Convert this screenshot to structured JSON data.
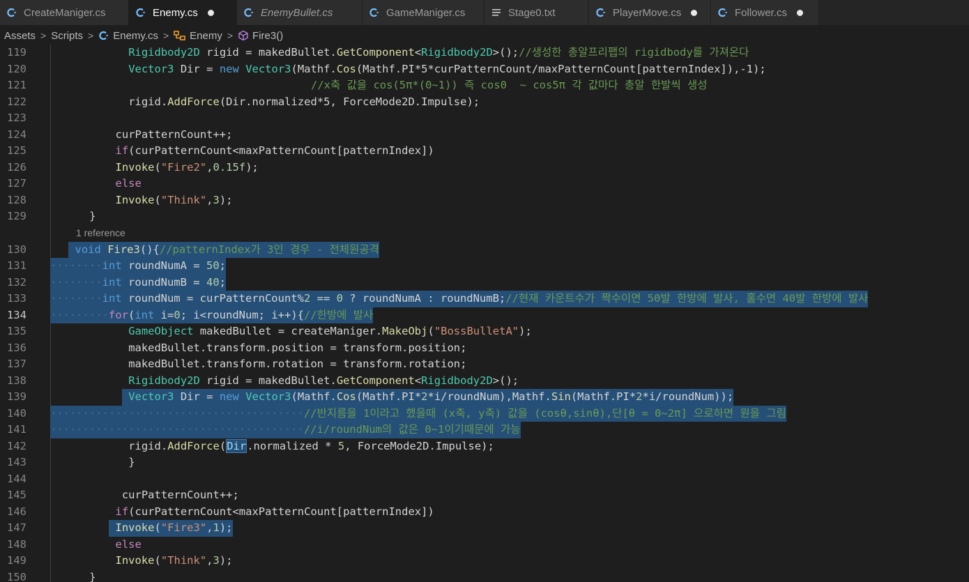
{
  "tabs": [
    {
      "label": "CreateManiger.cs",
      "icon": "csharp-icon",
      "active": false,
      "italic": false,
      "modified": false
    },
    {
      "label": "Enemy.cs",
      "icon": "csharp-icon",
      "active": true,
      "italic": false,
      "modified": true
    },
    {
      "label": "EnemyBullet.cs",
      "icon": "csharp-icon",
      "active": false,
      "italic": true,
      "modified": false
    },
    {
      "label": "GameManiger.cs",
      "icon": "csharp-icon",
      "active": false,
      "italic": false,
      "modified": false
    },
    {
      "label": "Stage0.txt",
      "icon": "text-file-icon",
      "active": false,
      "italic": false,
      "modified": false
    },
    {
      "label": "PlayerMove.cs",
      "icon": "csharp-icon",
      "active": false,
      "italic": false,
      "modified": true
    },
    {
      "label": "Follower.cs",
      "icon": "csharp-icon",
      "active": false,
      "italic": false,
      "modified": true
    }
  ],
  "breadcrumb": {
    "items": [
      "Assets",
      "Scripts",
      "Enemy.cs",
      "Enemy",
      "Fire3()"
    ]
  },
  "codelens": "1 reference",
  "current_line": 134,
  "colors": {
    "background": "#1e1e1e",
    "selection": "#264f78",
    "keyword": "#569cd6",
    "control": "#c586c0",
    "type": "#4ec9b0",
    "function": "#dcdcaa",
    "string": "#ce9178",
    "number": "#b5cea8",
    "comment": "#6a9955",
    "variable": "#9cdcfe"
  },
  "lines": [
    {
      "num": "119",
      "indent": "            ",
      "tokens": [
        [
          "t",
          "Rigidbody2D"
        ],
        [
          "p",
          " rigid = makedBullet."
        ],
        [
          "f",
          "GetComponent"
        ],
        [
          "p",
          "<"
        ],
        [
          "t",
          "Rigidbody2D"
        ],
        [
          "p",
          ">();"
        ],
        [
          "cm",
          "//생성한 총알프리팹의 rigidbody를 가져온다"
        ]
      ]
    },
    {
      "num": "120",
      "indent": "            ",
      "tokens": [
        [
          "t",
          "Vector3"
        ],
        [
          "p",
          " Dir = "
        ],
        [
          "k",
          "new"
        ],
        [
          "p",
          " "
        ],
        [
          "t",
          "Vector3"
        ],
        [
          "p",
          "(Mathf."
        ],
        [
          "f",
          "Cos"
        ],
        [
          "p",
          "(Mathf.PI*5*curPatternCount/maxPatternCount[patternIndex]),-1);"
        ]
      ]
    },
    {
      "num": "121",
      "indent": "                                        ",
      "tokens": [
        [
          "cm",
          "//x축 값을 cos(5π*(0~1)) 즉 cos0  ~ cos5π 각 값마다 총알 한발씩 생성"
        ]
      ]
    },
    {
      "num": "122",
      "indent": "            ",
      "tokens": [
        [
          "p",
          "rigid."
        ],
        [
          "f",
          "AddForce"
        ],
        [
          "p",
          "(Dir.normalized*5, ForceMode2D.Impulse);"
        ]
      ]
    },
    {
      "num": "123",
      "indent": "",
      "tokens": []
    },
    {
      "num": "124",
      "indent": "          ",
      "tokens": [
        [
          "p",
          "curPatternCount++;"
        ]
      ]
    },
    {
      "num": "125",
      "indent": "          ",
      "tokens": [
        [
          "c",
          "if"
        ],
        [
          "p",
          "(curPatternCount<maxPatternCount[patternIndex])"
        ]
      ]
    },
    {
      "num": "126",
      "indent": "          ",
      "tokens": [
        [
          "f",
          "Invoke"
        ],
        [
          "p",
          "("
        ],
        [
          "s",
          "\"Fire2\""
        ],
        [
          "p",
          ","
        ],
        [
          "n",
          "0.15f"
        ],
        [
          "p",
          ");"
        ]
      ]
    },
    {
      "num": "127",
      "indent": "          ",
      "tokens": [
        [
          "c",
          "else"
        ]
      ]
    },
    {
      "num": "128",
      "indent": "          ",
      "tokens": [
        [
          "f",
          "Invoke"
        ],
        [
          "p",
          "("
        ],
        [
          "s",
          "\"Think\""
        ],
        [
          "p",
          ","
        ],
        [
          "n",
          "3"
        ],
        [
          "p",
          ");"
        ]
      ]
    },
    {
      "num": "129",
      "indent": "      ",
      "tokens": [
        [
          "p",
          "}"
        ]
      ]
    },
    {
      "num": "130",
      "indent": "      ",
      "tokens": [
        [
          "k",
          "void"
        ],
        [
          "p",
          " "
        ],
        [
          "f",
          "Fire3"
        ],
        [
          "p",
          "(){"
        ],
        [
          "cm",
          "//patternIndex가 3인 경우 - 전체원공격"
        ]
      ],
      "sel": true
    },
    {
      "num": "131",
      "indent": "        ",
      "tokens": [
        [
          "k",
          "int"
        ],
        [
          "p",
          " roundNumA = "
        ],
        [
          "n",
          "50"
        ],
        [
          "p",
          ";"
        ]
      ],
      "sel": true
    },
    {
      "num": "132",
      "indent": "        ",
      "tokens": [
        [
          "k",
          "int"
        ],
        [
          "p",
          " roundNumB = "
        ],
        [
          "n",
          "40"
        ],
        [
          "p",
          ";"
        ]
      ],
      "sel": true
    },
    {
      "num": "133",
      "indent": "        ",
      "tokens": [
        [
          "k",
          "int"
        ],
        [
          "p",
          " roundNum = curPatternCount%"
        ],
        [
          "n",
          "2"
        ],
        [
          "p",
          " == "
        ],
        [
          "n",
          "0"
        ],
        [
          "p",
          " ? roundNumA : roundNumB;"
        ],
        [
          "cm",
          "//현재 카운트수가 짝수이면 50발 한방에 발사, 홀수면 40발 한방에 발사"
        ]
      ],
      "sel": true
    },
    {
      "num": "134",
      "indent": "         ",
      "tokens": [
        [
          "c",
          "for"
        ],
        [
          "p",
          "("
        ],
        [
          "k",
          "int"
        ],
        [
          "p",
          " i="
        ],
        [
          "n",
          "0"
        ],
        [
          "p",
          "; i<roundNum; i++){"
        ],
        [
          "cm",
          "//한방에 발사"
        ]
      ],
      "sel": true
    },
    {
      "num": "135",
      "indent": "            ",
      "tokens": [
        [
          "t",
          "GameObject"
        ],
        [
          "p",
          " makedBullet = createManiger."
        ],
        [
          "f",
          "MakeObj"
        ],
        [
          "p",
          "("
        ],
        [
          "s",
          "\"BossBulletA\""
        ],
        [
          "p",
          ");"
        ]
      ]
    },
    {
      "num": "136",
      "indent": "            ",
      "tokens": [
        [
          "p",
          "makedBullet.transform.position = transform.position;"
        ]
      ]
    },
    {
      "num": "137",
      "indent": "            ",
      "tokens": [
        [
          "p",
          "makedBullet.transform.rotation = transform.rotation;"
        ]
      ]
    },
    {
      "num": "138",
      "indent": "            ",
      "tokens": [
        [
          "t",
          "Rigidbody2D"
        ],
        [
          "p",
          " rigid = makedBullet."
        ],
        [
          "f",
          "GetComponent"
        ],
        [
          "p",
          "<"
        ],
        [
          "t",
          "Rigidbody2D"
        ],
        [
          "p",
          ">();"
        ]
      ]
    },
    {
      "num": "139",
      "indent": "            ",
      "tokens": [
        [
          "t",
          "Vector3"
        ],
        [
          "p",
          " Dir = "
        ],
        [
          "k",
          "new"
        ],
        [
          "p",
          " "
        ],
        [
          "t",
          "Vector3"
        ],
        [
          "p",
          "(Mathf."
        ],
        [
          "f",
          "Cos"
        ],
        [
          "p",
          "(Mathf.PI*"
        ],
        [
          "n",
          "2"
        ],
        [
          "p",
          "*i/roundNum),Mathf."
        ],
        [
          "f",
          "Sin"
        ],
        [
          "p",
          "(Mathf.PI*"
        ],
        [
          "n",
          "2"
        ],
        [
          "p",
          "*i/roundNum));"
        ]
      ],
      "sel": true
    },
    {
      "num": "140",
      "indent": "                                        ",
      "tokens": [
        [
          "cm",
          "//반지름을 1이라고 했을때 (x축, y축) 값을 (cosθ,sinθ),단[θ = 0~2π] 으로하면 원을 그림"
        ]
      ],
      "sel": true
    },
    {
      "num": "141",
      "indent": "                                        ",
      "tokens": [
        [
          "cm",
          "//i/roundNum의 값은 0~1이기때문에 가능"
        ]
      ],
      "sel": true
    },
    {
      "num": "142",
      "indent": "            ",
      "tokens": [
        [
          "p",
          "rigid."
        ],
        [
          "f",
          "AddForce"
        ],
        [
          "p",
          "("
        ],
        [
          "v",
          "Dir"
        ],
        [
          "p",
          ".normalized * "
        ],
        [
          "n",
          "5"
        ],
        [
          "p",
          ", ForceMode2D.Impulse);"
        ]
      ]
    },
    {
      "num": "143",
      "indent": "            ",
      "tokens": [
        [
          "p",
          "}"
        ]
      ]
    },
    {
      "num": "144",
      "indent": "",
      "tokens": []
    },
    {
      "num": "145",
      "indent": "           ",
      "tokens": [
        [
          "p",
          "curPatternCount++;"
        ]
      ]
    },
    {
      "num": "146",
      "indent": "          ",
      "tokens": [
        [
          "c",
          "if"
        ],
        [
          "p",
          "(curPatternCount<maxPatternCount[patternIndex])"
        ]
      ]
    },
    {
      "num": "147",
      "indent": "          ",
      "tokens": [
        [
          "f",
          "Invoke"
        ],
        [
          "p",
          "("
        ],
        [
          "s",
          "\"Fire3\""
        ],
        [
          "p",
          ","
        ],
        [
          "n",
          "1"
        ],
        [
          "p",
          ");"
        ]
      ],
      "sel": true
    },
    {
      "num": "148",
      "indent": "          ",
      "tokens": [
        [
          "c",
          "else"
        ]
      ]
    },
    {
      "num": "149",
      "indent": "          ",
      "tokens": [
        [
          "f",
          "Invoke"
        ],
        [
          "p",
          "("
        ],
        [
          "s",
          "\"Think\""
        ],
        [
          "p",
          ","
        ],
        [
          "n",
          "3"
        ],
        [
          "p",
          ");"
        ]
      ]
    },
    {
      "num": "150",
      "indent": "      ",
      "tokens": [
        [
          "p",
          "}"
        ]
      ]
    }
  ]
}
